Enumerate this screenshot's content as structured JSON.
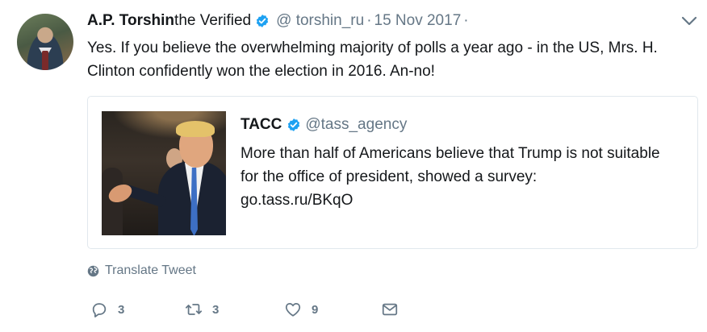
{
  "tweet": {
    "author_name": "A.P. Torshin",
    "author_suffix": "the Verified",
    "handle": "@ torshin_ru",
    "separator": "·",
    "date": "15 Nov 2017",
    "text": "Yes. If you believe the overwhelming majority of polls a year ago - in the US, Mrs. H. Clinton confidently won the election in 2016. An-no!",
    "trailing_separator": "·"
  },
  "quote": {
    "author_name": "TACC",
    "handle": "@tass_agency",
    "text": "More than half of Americans believe that Trump is not suitable for the office of president, showed a survey:",
    "link": "go.tass.ru/BKqO"
  },
  "translate": {
    "label": "Translate Tweet"
  },
  "actions": {
    "reply_count": "3",
    "retweet_count": "3",
    "like_count": "9"
  },
  "icons": {
    "verified": "verified-badge-icon",
    "caret": "chevron-down-icon",
    "globe": "globe-icon",
    "reply": "reply-icon",
    "retweet": "retweet-icon",
    "like": "heart-icon",
    "dm": "envelope-icon"
  },
  "colors": {
    "verified_blue": "#1da1f2",
    "secondary_text": "#657786",
    "border": "#e1e8ed"
  }
}
